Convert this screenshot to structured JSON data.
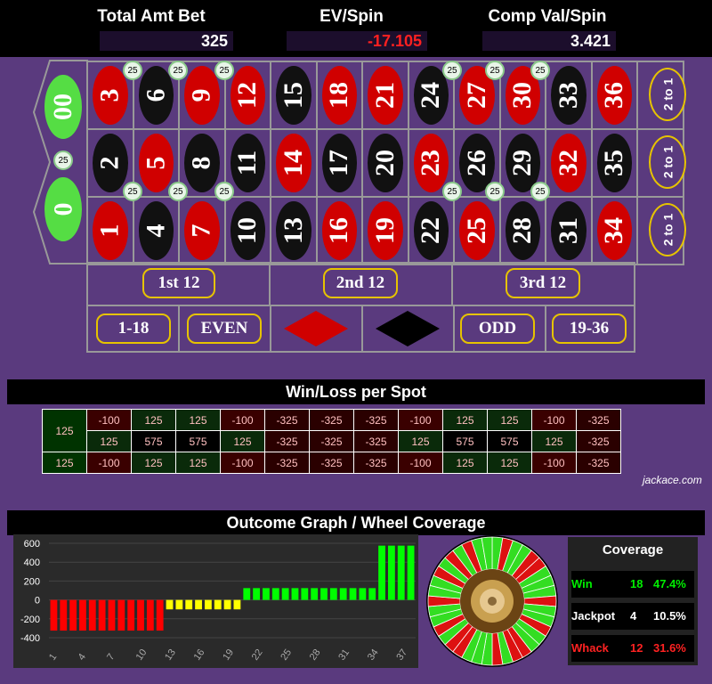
{
  "header": {
    "total_bet_label": "Total Amt Bet",
    "total_bet": "325",
    "ev_label": "EV/Spin",
    "ev": "-17.105",
    "comp_label": "Comp Val/Spin",
    "comp": "3.421"
  },
  "board": {
    "zero": "0",
    "double_zero": "00",
    "numbers": [
      "1",
      "2",
      "3",
      "4",
      "5",
      "6",
      "7",
      "8",
      "9",
      "10",
      "11",
      "12",
      "13",
      "14",
      "15",
      "16",
      "17",
      "18",
      "19",
      "20",
      "21",
      "22",
      "23",
      "24",
      "25",
      "26",
      "27",
      "28",
      "29",
      "30",
      "31",
      "32",
      "33",
      "34",
      "35",
      "36"
    ],
    "column_label": "2 to 1",
    "dozens": [
      "1st 12",
      "2nd 12",
      "3rd 12"
    ],
    "low": "1-18",
    "even": "EVEN",
    "odd": "ODD",
    "high": "19-36",
    "chip_value": "25"
  },
  "winloss": {
    "title": "Win/Loss per Spot",
    "left": [
      "125",
      "125"
    ],
    "rows": [
      [
        "-100",
        "125",
        "125",
        "-100",
        "-325",
        "-325",
        "-325",
        "-100",
        "125",
        "125",
        "-100",
        "-325"
      ],
      [
        "125",
        "575",
        "575",
        "125",
        "-325",
        "-325",
        "-325",
        "125",
        "575",
        "575",
        "125",
        "-325"
      ],
      [
        "-100",
        "125",
        "125",
        "-100",
        "-325",
        "-325",
        "-325",
        "-100",
        "125",
        "125",
        "-100",
        "-325"
      ]
    ],
    "credit": "jackace.com"
  },
  "outcome": {
    "title": "Outcome Graph / Wheel Coverage",
    "y_ticks": [
      "600",
      "400",
      "200",
      "0",
      "-200",
      "-400"
    ],
    "x_ticks": [
      "1",
      "4",
      "7",
      "10",
      "13",
      "16",
      "19",
      "22",
      "25",
      "28",
      "31",
      "34",
      "37"
    ]
  },
  "chart_data": {
    "type": "bar",
    "ylim": [
      -400,
      600
    ],
    "values": [
      -325,
      -325,
      -325,
      -325,
      -325,
      -325,
      -325,
      -325,
      -325,
      -325,
      -325,
      -325,
      -100,
      -100,
      -100,
      -100,
      -100,
      -100,
      -100,
      -100,
      125,
      125,
      125,
      125,
      125,
      125,
      125,
      125,
      125,
      125,
      125,
      125,
      125,
      125,
      575,
      575,
      575,
      575
    ],
    "colors": {
      "loss": "#ff0000",
      "small": "#ffff00",
      "win": "#00ff00"
    }
  },
  "coverage": {
    "title": "Coverage",
    "rows": [
      {
        "label": "Win",
        "count": "18",
        "pct": "47.4%",
        "color": "#00ee00"
      },
      {
        "label": "Jackpot",
        "count": "4",
        "pct": "10.5%",
        "color": "#ffffff"
      },
      {
        "label": "Whack",
        "count": "12",
        "pct": "31.6%",
        "color": "#ff2222"
      }
    ]
  }
}
